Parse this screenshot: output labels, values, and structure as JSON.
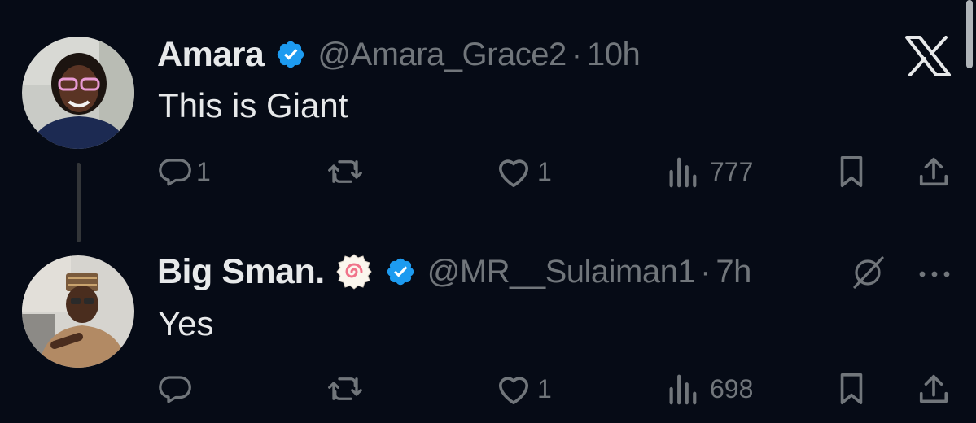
{
  "tweets": [
    {
      "display_name": "Amara",
      "handle": "@Amara_Grace2",
      "separator": "·",
      "time": "10h",
      "text": "This is Giant",
      "verified": true,
      "actions": {
        "replies": "1",
        "reposts": "",
        "likes": "1",
        "views": "777"
      }
    },
    {
      "display_name": "Big Sman.",
      "name_emoji": "fish-cake-emoji",
      "handle": "@MR__Sulaiman1",
      "separator": "·",
      "time": "7h",
      "text": "Yes",
      "verified": true,
      "actions": {
        "replies": "",
        "reposts": "",
        "likes": "1",
        "views": "698"
      }
    }
  ],
  "icons": {
    "brand": "x-logo-icon",
    "grok": "grok-icon",
    "more": "more-options-icon",
    "reply": "reply-icon",
    "repost": "repost-icon",
    "like": "heart-icon",
    "views": "views-icon",
    "bookmark": "bookmark-icon",
    "share": "share-icon"
  },
  "colors": {
    "background": "#060b16",
    "text_primary": "#e7e9ea",
    "text_secondary": "#71767b",
    "verified_blue": "#1d9bf0",
    "divider": "#2f3336"
  }
}
